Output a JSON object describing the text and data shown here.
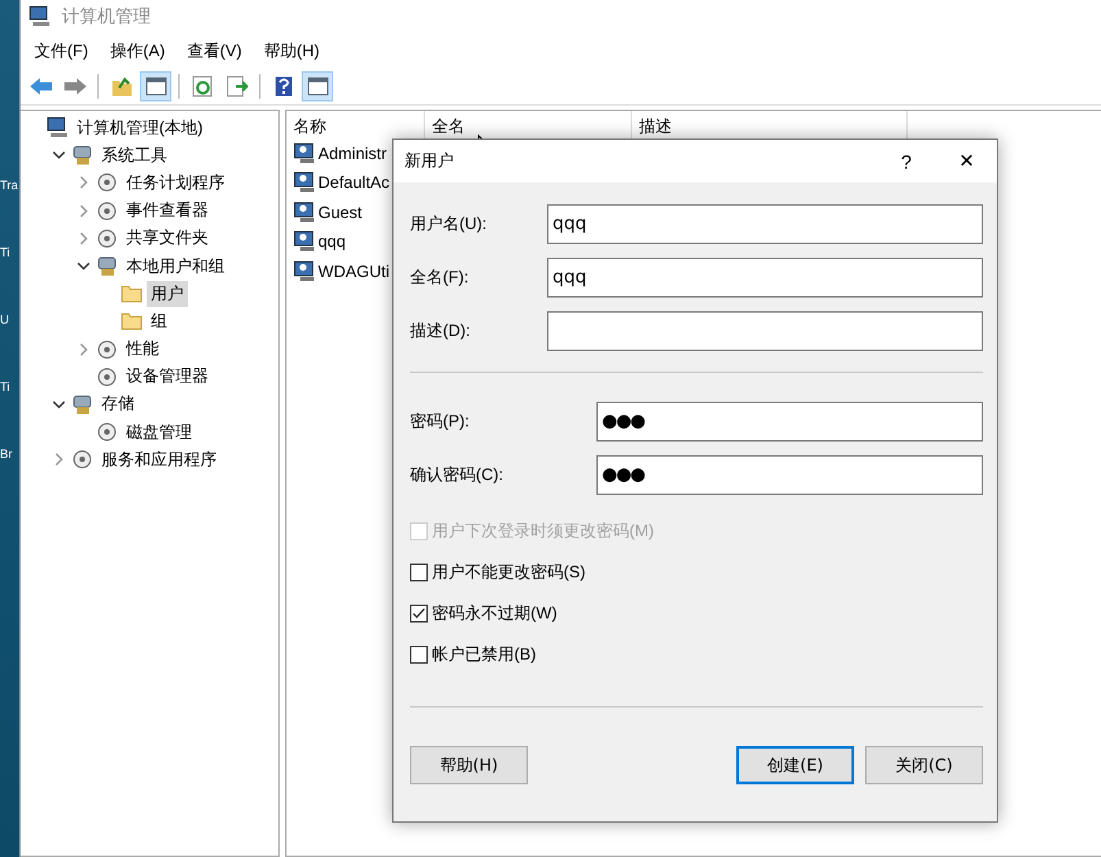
{
  "desktop": {
    "labels": [
      "Tra",
      "Ti",
      "U",
      "Ti",
      "Br"
    ]
  },
  "window": {
    "title": "计算机管理"
  },
  "menu": [
    "文件(F)",
    "操作(A)",
    "查看(V)",
    "帮助(H)"
  ],
  "toolbar": [
    {
      "pressed": false
    },
    {
      "pressed": false
    },
    {
      "pressed": false
    },
    {
      "pressed": true
    },
    {
      "pressed": false
    },
    {
      "pressed": false
    },
    {
      "pressed": false
    },
    {
      "pressed": true
    }
  ],
  "tree": [
    {
      "label": "计算机管理(本地)",
      "children": [
        {
          "label": "系统工具",
          "expanded": true,
          "children": [
            {
              "label": "任务计划程序",
              "expanded": false,
              "selected": false
            },
            {
              "label": "事件查看器",
              "expanded": false,
              "selected": false
            },
            {
              "label": "共享文件夹",
              "expanded": false,
              "selected": false
            },
            {
              "label": "本地用户和组",
              "expanded": true,
              "selected": false,
              "children": [
                {
                  "label": "用户",
                  "selected": true
                },
                {
                  "label": "组",
                  "selected": false
                }
              ]
            },
            {
              "label": "性能",
              "expanded": false,
              "selected": false
            },
            {
              "label": "设备管理器",
              "selected": false
            }
          ],
          "selected": false
        },
        {
          "label": "存储",
          "expanded": true,
          "selected": false,
          "children": [
            {
              "label": "磁盘管理",
              "selected": false
            }
          ]
        },
        {
          "label": "服务和应用程序",
          "expanded": false,
          "selected": false
        }
      ],
      "selected": false
    }
  ],
  "table": {
    "columns": [
      "名称",
      "全名",
      "描述"
    ],
    "rows": [
      {
        "name": "Administr"
      },
      {
        "name": "DefaultAc"
      },
      {
        "name": "Guest"
      },
      {
        "name": "qqq"
      },
      {
        "name": "WDAGUti"
      }
    ]
  },
  "dialog": {
    "title": "新用户",
    "help": "?",
    "close": "✕",
    "fields": [
      {
        "label": "用户名(U):",
        "value": "qqq",
        "kind": "text"
      },
      {
        "label": "全名(F):",
        "value": "qqq",
        "kind": "text"
      },
      {
        "label": "描述(D):",
        "kind": "text"
      },
      {
        "label": "密码(P):",
        "value": "●●●",
        "kind": "password"
      },
      {
        "label": "确认密码(C):",
        "value": "●●●",
        "kind": "password"
      }
    ],
    "checkboxes": [
      {
        "label": "用户下次登录时须更改密码(M)",
        "checked": false,
        "disabled": true
      },
      {
        "label": "用户不能更改密码(S)",
        "checked": false,
        "disabled": false
      },
      {
        "label": "密码永不过期(W)",
        "checked": true,
        "disabled": false
      },
      {
        "label": "帐户已禁用(B)",
        "checked": false,
        "disabled": false
      }
    ],
    "buttons": [
      {
        "label": "帮助(H)",
        "default": false
      },
      {
        "label": "创建(E)",
        "default": true
      },
      {
        "label": "关闭(C)",
        "default": false
      }
    ]
  }
}
